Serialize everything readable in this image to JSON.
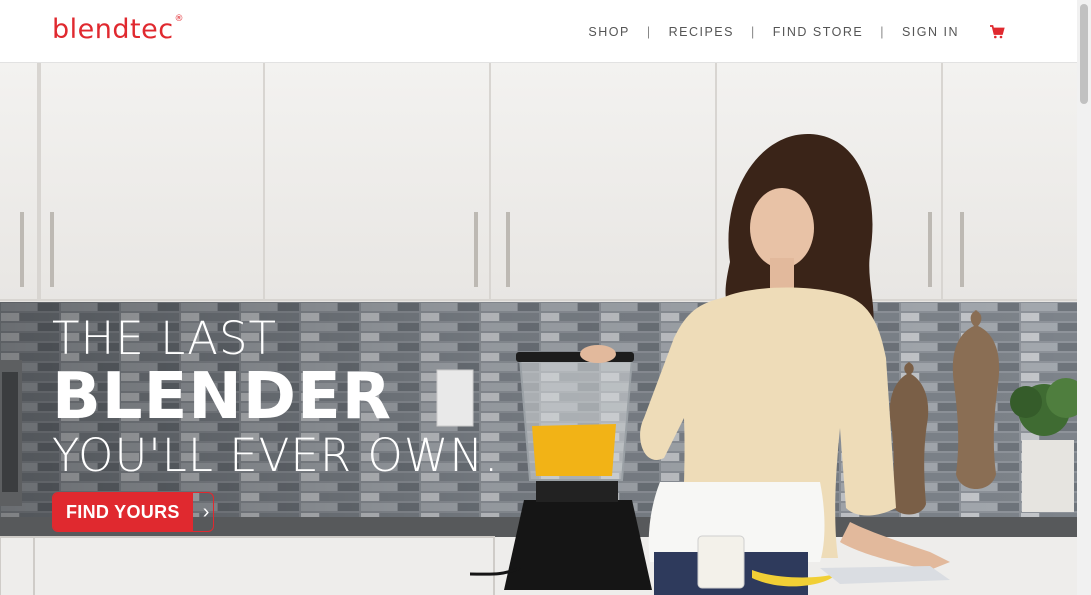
{
  "brand": {
    "logo_text": "blendtec",
    "logo_mark": "®",
    "color": "#e0292f"
  },
  "nav": {
    "items": [
      {
        "label": "SHOP"
      },
      {
        "label": "RECIPES"
      },
      {
        "label": "FIND STORE"
      },
      {
        "label": "SIGN IN"
      }
    ],
    "separator": "|",
    "cart_icon": "shopping-cart-icon"
  },
  "hero": {
    "line1": "THE LAST",
    "line2": "BLENDER",
    "line3": "YOU'LL EVER OWN.",
    "cta_label": "FIND YOURS",
    "cta_icon": "chevron-right-icon",
    "cta_chevron": "›",
    "image_description_icon": "hero-kitchen-photo"
  }
}
